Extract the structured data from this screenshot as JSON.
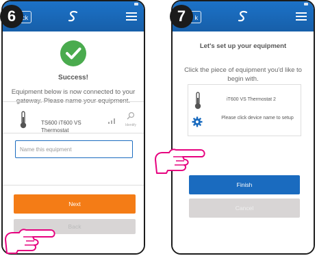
{
  "steps": {
    "left": "6",
    "right": "7"
  },
  "left_screen": {
    "back_label": "ck",
    "success_title": "Success!",
    "success_desc": "Equipment below is now connected to your gateway. Please name your equipment.",
    "device_name": "TS600 iT600 VS Thermostat",
    "identify_label": "Identify",
    "name_input_placeholder": "Name this equipment",
    "next_label": "Next",
    "back_bottom_label": "Back"
  },
  "right_screen": {
    "back_label": "k",
    "setup_title": "Let's set up your equipment",
    "setup_desc": "Click the piece of equipment you'd like to begin with.",
    "device_name": "iT600 VS Thermostat 2",
    "setup_hint": "Please click device name to setup",
    "finish_label": "Finish",
    "cancel_label": "Cancel"
  },
  "colors": {
    "header_blue": "#1a6bbf",
    "success_green": "#4aab4e",
    "next_orange": "#f47c16",
    "finish_blue": "#1a6bbf",
    "cancel_gray": "#d8d5d5",
    "step_badge": "#1b1b1b",
    "hand_outline": "#e6007e"
  },
  "icons": [
    "logo-icon",
    "menu-icon",
    "check-circle-icon",
    "thermostat-icon",
    "signal-icon",
    "identify-icon",
    "gear-icon",
    "pointing-hand-icon"
  ]
}
